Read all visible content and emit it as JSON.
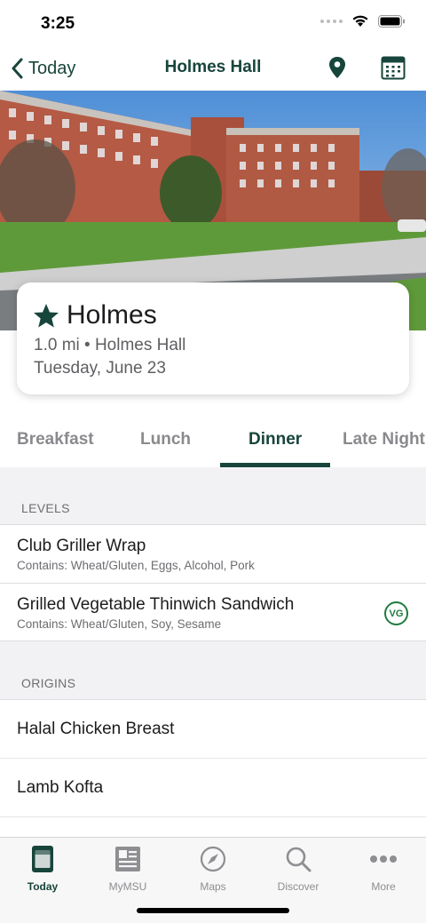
{
  "status_bar": {
    "time": "3:25"
  },
  "nav": {
    "back_label": "Today",
    "title": "Holmes Hall",
    "location_icon": "map-pin-icon",
    "calendar_icon": "calendar-icon"
  },
  "card": {
    "name": "Holmes",
    "distance_line": "1.0 mi • Holmes Hall",
    "date": "Tuesday, June 23"
  },
  "meal_tabs": [
    {
      "label": "Breakfast",
      "active": false
    },
    {
      "label": "Lunch",
      "active": false
    },
    {
      "label": "Dinner",
      "active": true
    },
    {
      "label": "Late Night",
      "active": false
    }
  ],
  "sections": [
    {
      "title": "LEVELS",
      "items": [
        {
          "name": "Club Griller Wrap",
          "contains": "Contains: Wheat/Gluten, Eggs, Alcohol, Pork"
        },
        {
          "name": "Grilled Vegetable Thinwich Sandwich",
          "contains": "Contains: Wheat/Gluten, Soy, Sesame",
          "badge": "VG"
        }
      ]
    },
    {
      "title": "ORIGINS",
      "items": [
        {
          "name": "Halal Chicken Breast"
        },
        {
          "name": "Lamb Kofta"
        }
      ]
    }
  ],
  "tab_bar": [
    {
      "label": "Today",
      "icon": "today-icon",
      "active": true
    },
    {
      "label": "MyMSU",
      "icon": "newspaper-icon",
      "active": false
    },
    {
      "label": "Maps",
      "icon": "compass-icon",
      "active": false
    },
    {
      "label": "Discover",
      "icon": "search-icon",
      "active": false
    },
    {
      "label": "More",
      "icon": "more-dots-icon",
      "active": false
    }
  ],
  "colors": {
    "accent": "#18453b",
    "vg_badge": "#1f7a3d",
    "inactive": "#8e8e93"
  }
}
